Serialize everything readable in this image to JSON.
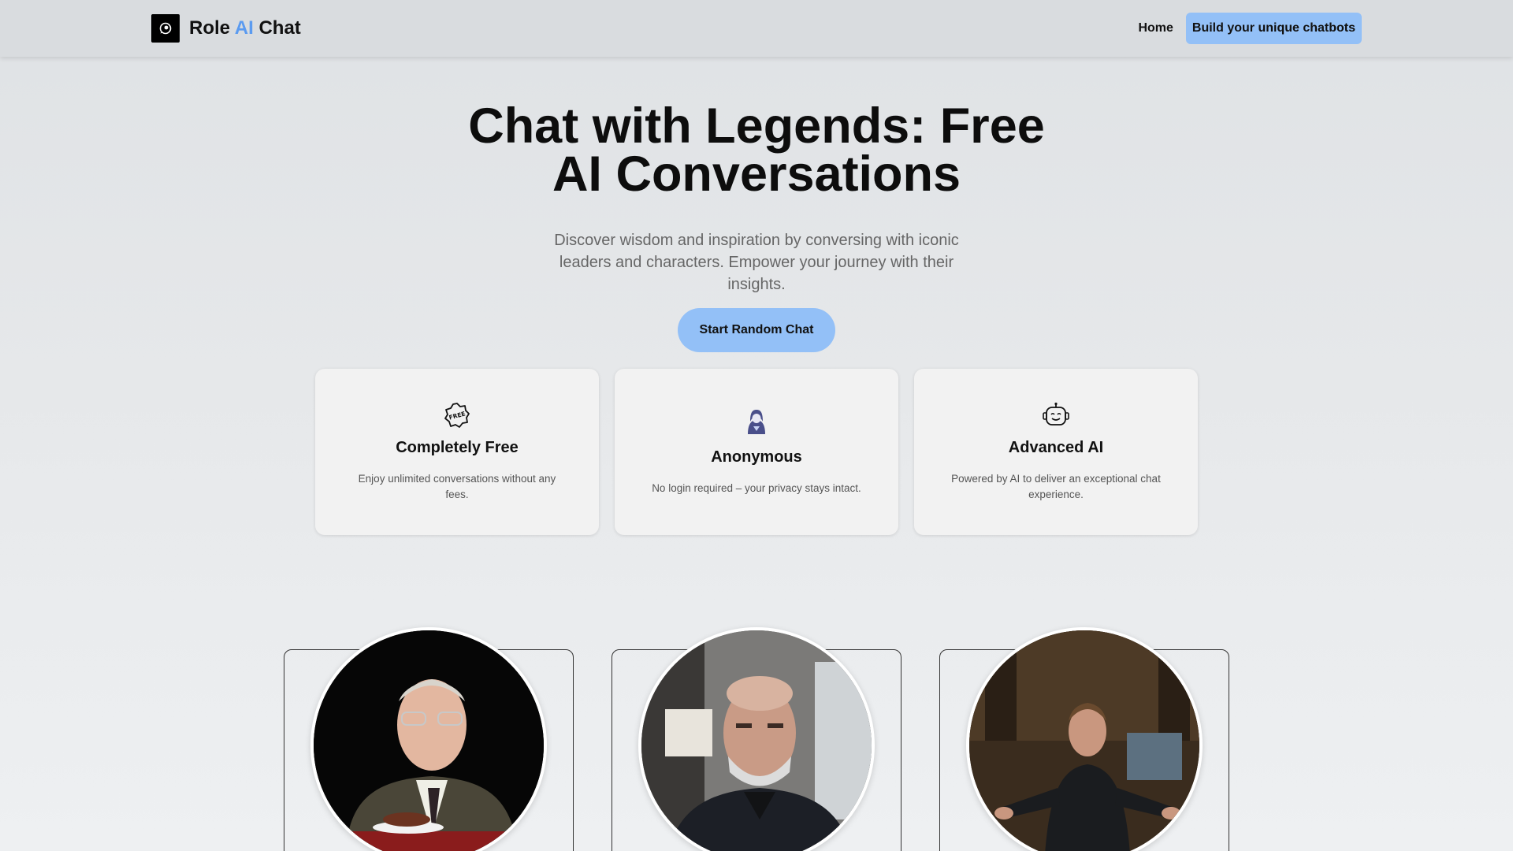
{
  "header": {
    "brand_part1": "Role",
    "brand_part2": "AI",
    "brand_part3": "Chat",
    "nav_home": "Home",
    "nav_build": "Build your unique chatbots"
  },
  "hero": {
    "title": "Chat with Legends: Free AI Conversations",
    "subtitle": "Discover wisdom and inspiration by conversing with iconic leaders and characters. Empower your journey with their insights.",
    "cta": "Start Random Chat"
  },
  "features": [
    {
      "icon": "free-badge-icon",
      "title": "Completely Free",
      "desc": "Enjoy unlimited conversations without any fees."
    },
    {
      "icon": "anonymous-user-icon",
      "title": "Anonymous",
      "desc": "No login required – your privacy stays intact."
    },
    {
      "icon": "robot-icon",
      "title": "Advanced AI",
      "desc": "Powered by AI to deliver an exceptional chat experience."
    }
  ],
  "colors": {
    "accent": "#93c0f7",
    "brand_ai": "#5b9bf0"
  }
}
